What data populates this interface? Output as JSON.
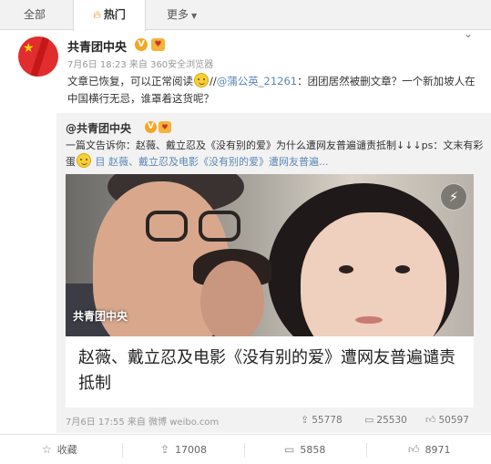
{
  "tabs": [
    {
      "label": "全部"
    },
    {
      "label": "热门",
      "icon": "fire-icon"
    },
    {
      "label": "更多",
      "icon": "caret-down-icon"
    }
  ],
  "post": {
    "author": "共青团中央",
    "verified_badge": "V",
    "medal": "♥",
    "meta": "7月6日 18:23 来自 360安全浏览器",
    "text_1": "文章已恢复，可以正常阅读",
    "text_2": "//",
    "mention": "@蒲公英_21261",
    "text_3": "：团团居然被删文章？一个新加坡人在中国横行无忌，谁罩着这货呢？"
  },
  "repost": {
    "author": "@共青团中央",
    "text_1": "一篇文告诉你：赵薇、戴立忍及《没有别的爱》为什么遭网友普遍谴责抵制↓↓↓ps：文末有彩蛋",
    "link_text": "目 赵薇、戴立忍及电影《没有别的爱》遭网友普遍...",
    "image_watermark": "共青团中央",
    "card_title": "赵薇、戴立忍及电影《没有别的爱》遭网友普遍谴责抵制",
    "meta": "7月6日 17:55 来自 微博 weibo.com",
    "reposts": "55778",
    "comments": "25530",
    "likes": "50597"
  },
  "actions": {
    "favorite_label": "收藏",
    "repost_count": "17008",
    "comment_count": "5858",
    "like_count": "8971"
  },
  "icons": {
    "bolt": "⚡",
    "chevron": "⌄"
  },
  "colors": {
    "link": "#5c87b7",
    "hot_fire": "#f28c28",
    "verified": "#f5a623"
  }
}
